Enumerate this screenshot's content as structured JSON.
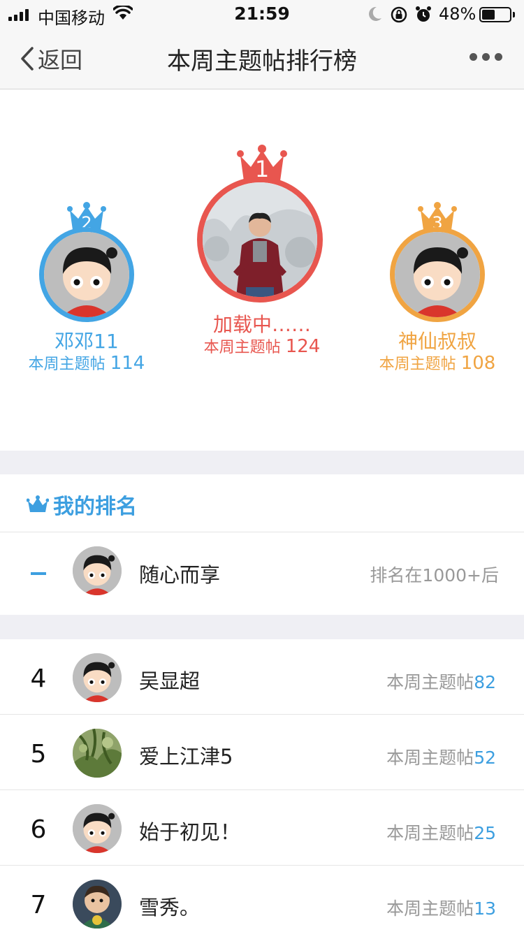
{
  "status_bar": {
    "carrier": "中国移动",
    "time": "21:59",
    "battery_pct": "48%",
    "battery_level": 0.48
  },
  "nav": {
    "back_label": "返回",
    "title": "本周主题帖排行榜"
  },
  "podium": {
    "first": {
      "rank": "1",
      "name": "加载中……",
      "label": "本周主题帖",
      "count": "124",
      "color": "#e8564f"
    },
    "second": {
      "rank": "2",
      "name": "邓邓11",
      "label": "本周主题帖",
      "count": "114",
      "color": "#43a5e4"
    },
    "third": {
      "rank": "3",
      "name": "神仙叔叔",
      "label": "本周主题帖",
      "count": "108",
      "color": "#f0a442"
    }
  },
  "my_rank": {
    "title": "我的排名",
    "name": "随心而享",
    "status": "排名在1000+后"
  },
  "list": [
    {
      "rank": "4",
      "name": "吴显超",
      "label": "本周主题帖",
      "count": "82"
    },
    {
      "rank": "5",
      "name": "爱上江津5",
      "label": "本周主题帖",
      "count": "52"
    },
    {
      "rank": "6",
      "name": "始于初见！",
      "label": "本周主题帖",
      "count": "25"
    },
    {
      "rank": "7",
      "name": "雪秀。",
      "label": "本周主题帖",
      "count": "13"
    }
  ]
}
